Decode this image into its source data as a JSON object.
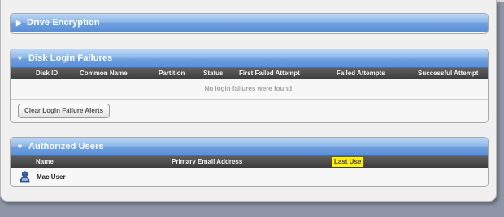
{
  "drive_encryption": {
    "title": "Drive Encryption",
    "arrow": "▶"
  },
  "disk_login_failures": {
    "title": "Disk Login Failures",
    "arrow": "▼",
    "columns": [
      "Disk ID",
      "Common Name",
      "Partition",
      "Status",
      "First Failed Attempt",
      "Failed Attempts",
      "Successful Attempt"
    ],
    "empty_message": "No login failures were found.",
    "clear_button_label": "Clear Login Failure Alerts"
  },
  "authorized_users": {
    "title": "Authorized Users",
    "arrow": "▼",
    "columns": [
      "Name",
      "Primary Email Address",
      "Last Use"
    ],
    "users": [
      {
        "name": "Mac User",
        "email": "",
        "last_use": ""
      }
    ]
  },
  "colors": {
    "header_blue": "#6e9fde",
    "highlight": "#fff200"
  },
  "icons": {
    "user": "user-icon"
  }
}
